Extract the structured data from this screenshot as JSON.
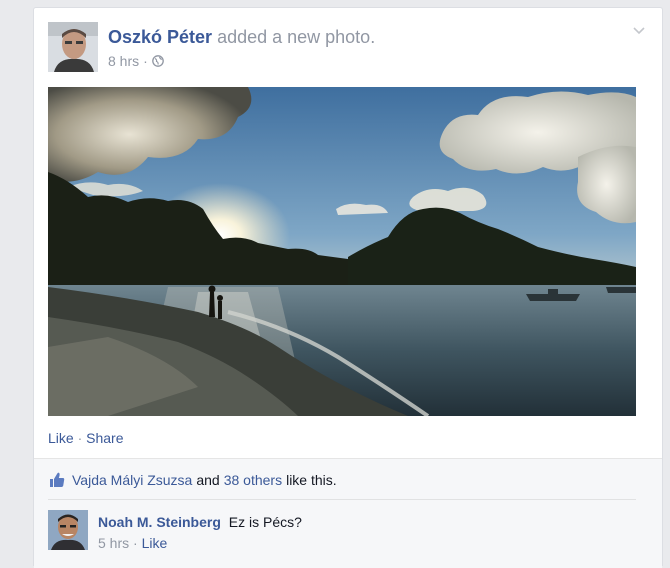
{
  "post": {
    "author": "Oszkó Péter",
    "action": "added a new photo.",
    "time": "8 hrs",
    "separator": "·",
    "audience_icon": "globe-icon",
    "menu_icon": "chevron-down-icon"
  },
  "actions": {
    "like": "Like",
    "separator": "·",
    "share": "Share"
  },
  "likes": {
    "icon": "thumbs-up-icon",
    "liker": "Vajda Mályi Zsuzsa",
    "and": "and",
    "others": "38 others",
    "suffix": "like this."
  },
  "comment": {
    "author": "Noah M. Steinberg",
    "text": "Ez is Pécs?",
    "time": "5 hrs",
    "separator": "·",
    "like": "Like"
  },
  "colors": {
    "link": "#3b5998",
    "muted": "#9197a3",
    "ufi_background": "#f6f7f9"
  }
}
